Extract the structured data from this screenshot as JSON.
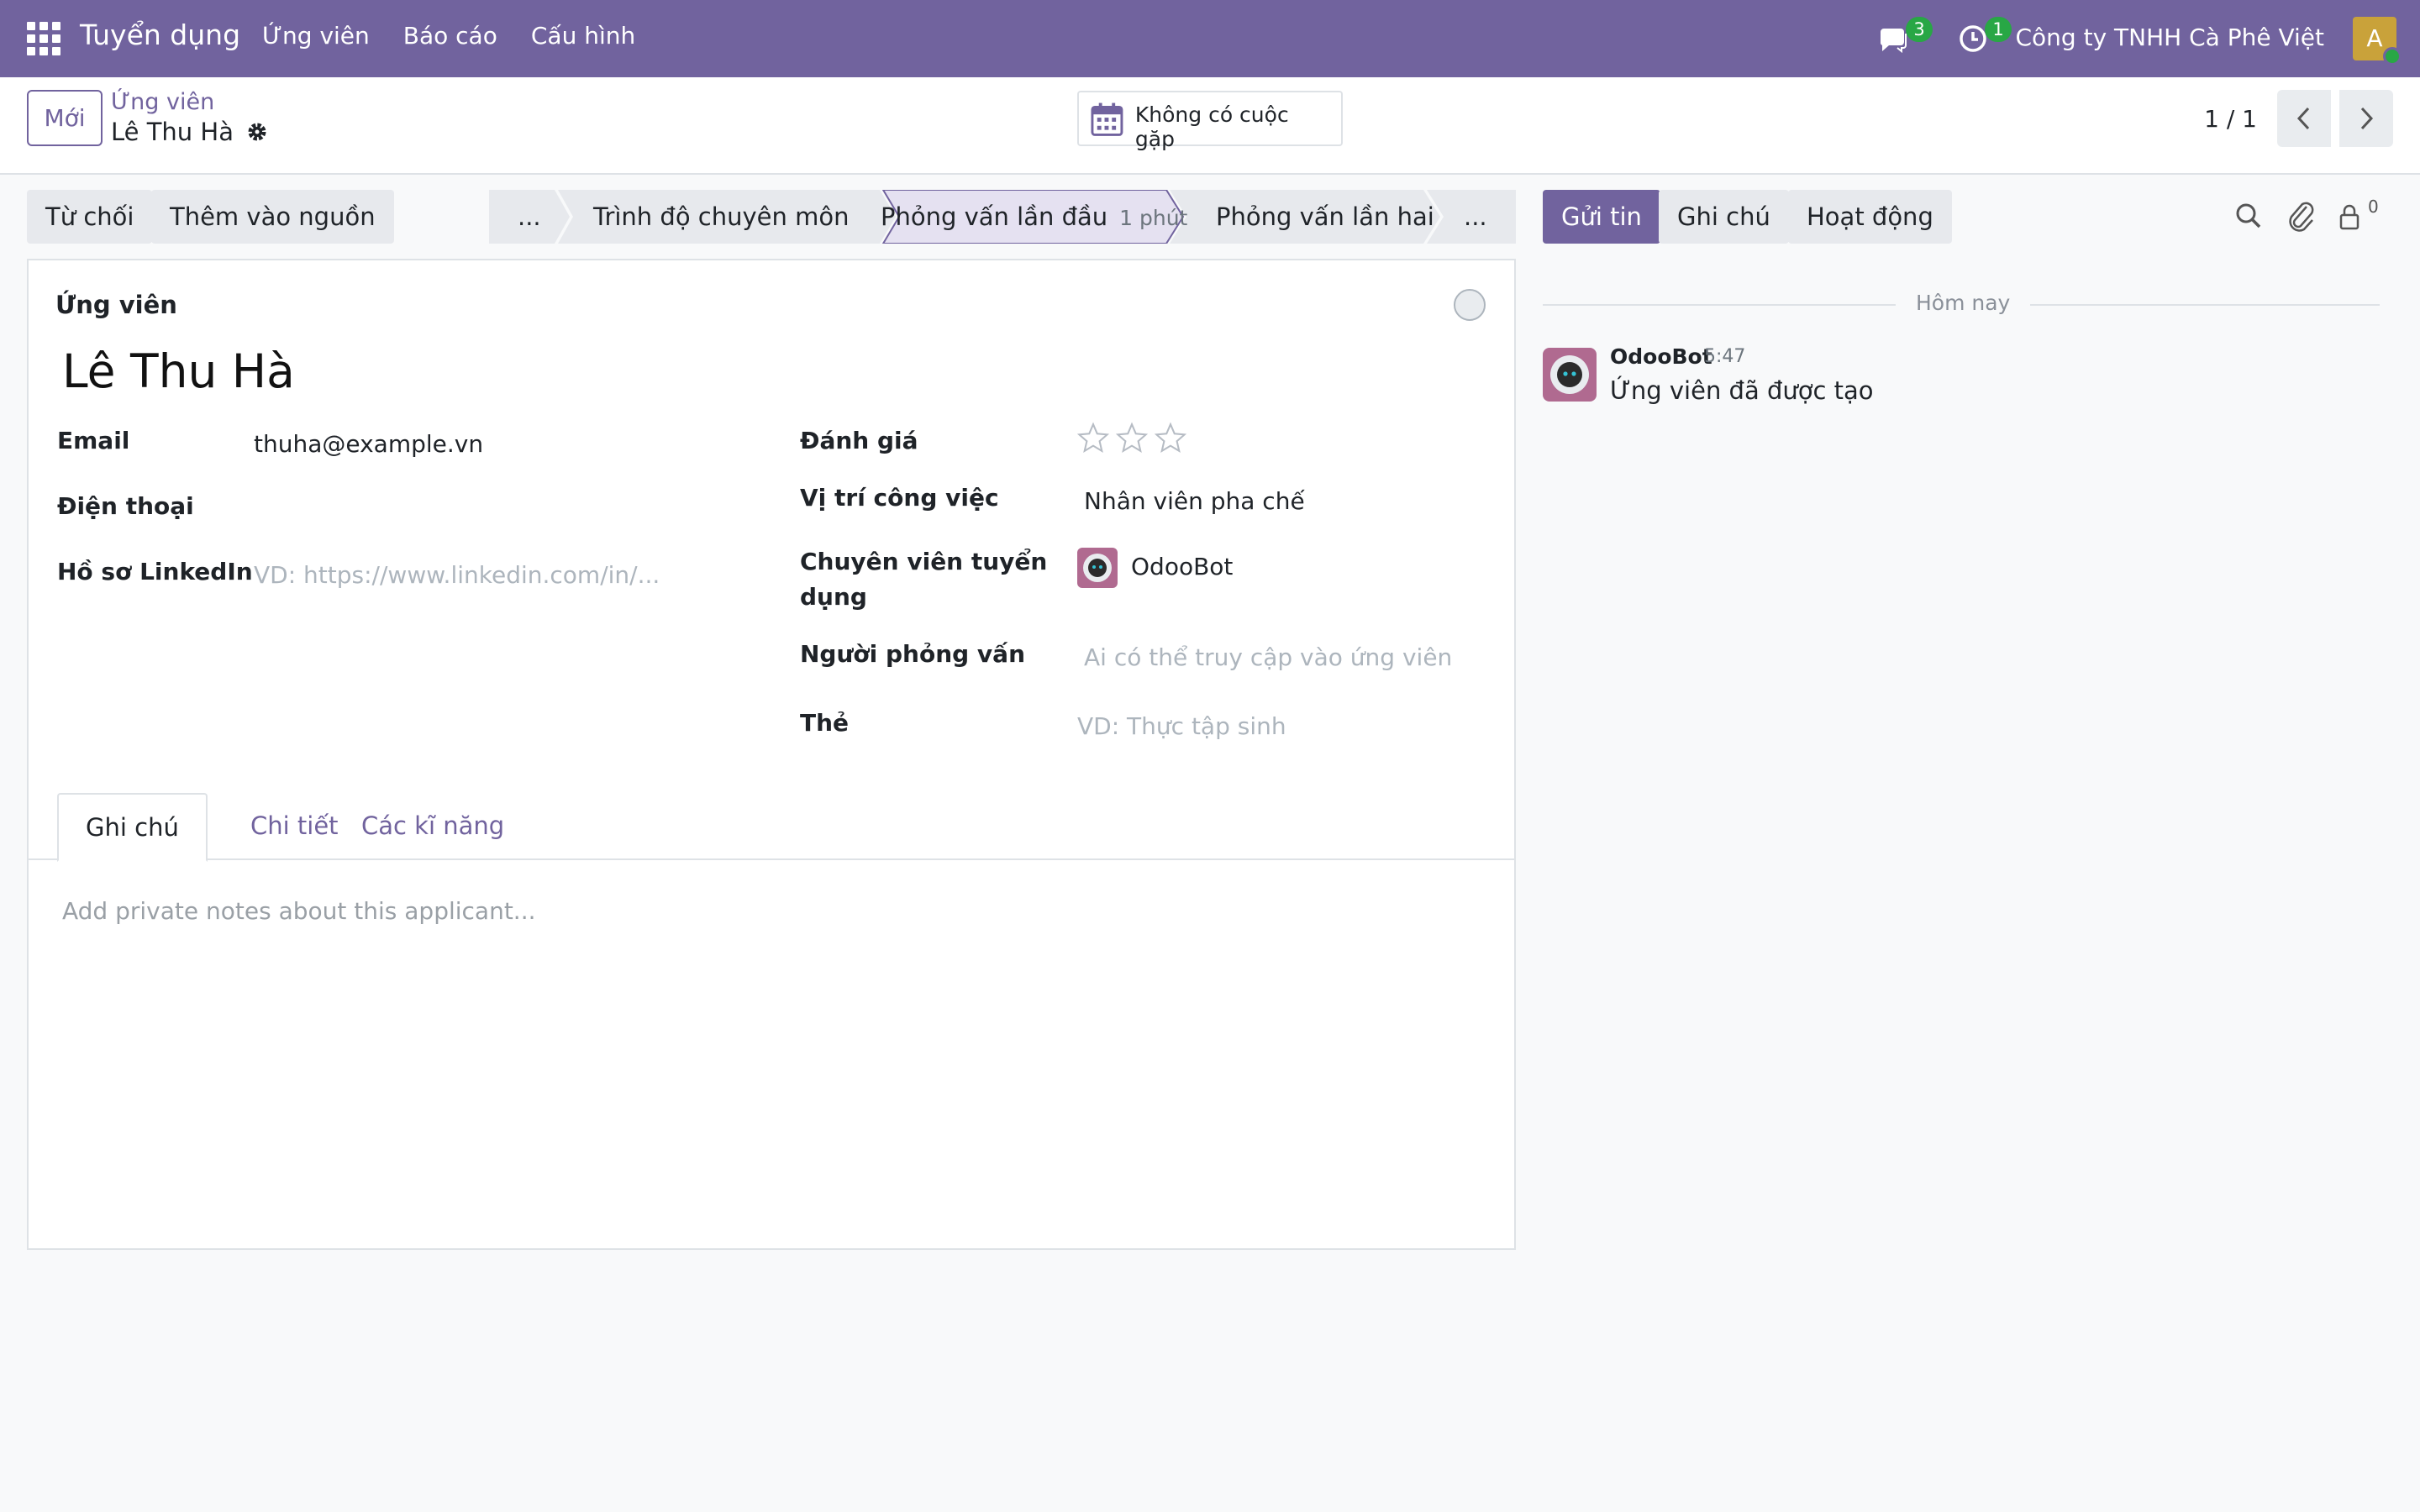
{
  "navbar": {
    "app_name": "Tuyển dụng",
    "menu": [
      "Ứng viên",
      "Báo cáo",
      "Cấu hình"
    ],
    "messages_count": "3",
    "activities_count": "1",
    "company": "Công ty TNHH Cà Phê Việt",
    "user_initial": "A",
    "brand_color": "#71639e"
  },
  "control": {
    "new_button": "Mới",
    "breadcrumb_parent": "Ứng viên",
    "breadcrumb_current": "Lê Thu Hà",
    "meeting_button": "Không có cuộc gặp",
    "pager_value": "1 / 1"
  },
  "statusbar": {
    "refuse": "Từ chối",
    "add_to_pool": "Thêm vào nguồn",
    "stages": [
      "...",
      "Trình độ chuyên môn",
      "Phỏng vấn lần đầu",
      "Phỏng vấn lần hai",
      "..."
    ],
    "active_stage_duration": "1 phút"
  },
  "form": {
    "title_label": "Ứng viên",
    "applicant_name": "Lê Thu Hà",
    "email_label": "Email",
    "email_value": "thuha@example.vn",
    "phone_label": "Điện thoại",
    "linkedin_label": "Hồ sơ LinkedIn",
    "linkedin_placeholder": "VD: https://www.linkedin.com/in/...",
    "rating_label": "Đánh giá",
    "rating_value": 0,
    "rating_max": 3,
    "job_label": "Vị trí công việc",
    "job_value": "Nhân viên pha chế",
    "recruiter_label_1": "Chuyên viên tuyển",
    "recruiter_label_2": "dụng",
    "recruiter_value": "OdooBot",
    "interviewer_label": "Người phỏng vấn",
    "interviewer_placeholder": "Ai có thể truy cập vào ứng viên",
    "tags_label": "Thẻ",
    "tags_placeholder": "VD: Thực tập sinh"
  },
  "tabs": {
    "notes": "Ghi chú",
    "details": "Chi tiết",
    "skills": "Các kĩ năng",
    "notes_placeholder": "Add private notes about this applicant..."
  },
  "chatter": {
    "send_message": "Gửi tin",
    "log_note": "Ghi chú",
    "activities": "Hoạt động",
    "followers_count": "0",
    "date_separator": "Hôm nay",
    "message": {
      "author": "OdooBot",
      "time": "5:47",
      "body": "Ứng viên đã được tạo"
    }
  }
}
